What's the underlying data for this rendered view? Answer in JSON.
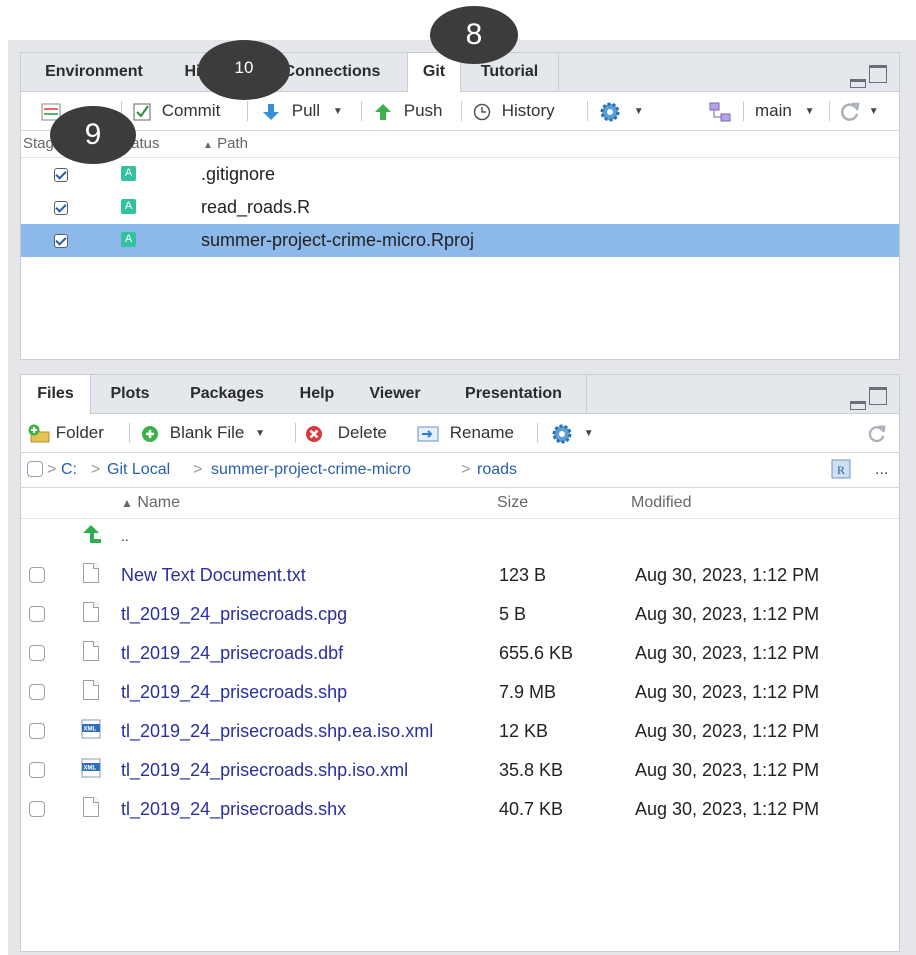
{
  "git_pane": {
    "tabs": [
      {
        "label": "Environment"
      },
      {
        "label": "History"
      },
      {
        "label": "Connections"
      },
      {
        "label": "Git"
      },
      {
        "label": "Tutorial"
      }
    ],
    "toolbar": {
      "commit_label": "Commit",
      "pull_label": "Pull",
      "push_label": "Push",
      "history_label": "History",
      "branch_label": "main"
    },
    "columns": {
      "staged": "Staged",
      "status": "Status",
      "path": "Path"
    },
    "rows": [
      {
        "staged": true,
        "status": "A",
        "path": ".gitignore",
        "selected": false
      },
      {
        "staged": true,
        "status": "A",
        "path": "read_roads.R",
        "selected": false
      },
      {
        "staged": true,
        "status": "A",
        "path": "summer-project-crime-micro.Rproj",
        "selected": true
      }
    ]
  },
  "files_pane": {
    "tabs": [
      {
        "label": "Files"
      },
      {
        "label": "Plots"
      },
      {
        "label": "Packages"
      },
      {
        "label": "Help"
      },
      {
        "label": "Viewer"
      },
      {
        "label": "Presentation"
      }
    ],
    "toolbar": {
      "folder_label": "Folder",
      "blank_file_label": "Blank File",
      "delete_label": "Delete",
      "rename_label": "Rename",
      "more_label": "..."
    },
    "breadcrumb": [
      "C:",
      "Git Local",
      "summer-project-crime-micro",
      "roads"
    ],
    "columns": {
      "name": "Name",
      "size": "Size",
      "modified": "Modified"
    },
    "parent_label": "..",
    "files": [
      {
        "name": "New Text Document.txt",
        "size": "123 B",
        "modified": "Aug 30, 2023, 1:12 PM",
        "icon": "text-file-icon"
      },
      {
        "name": "tl_2019_24_prisecroads.cpg",
        "size": "5 B",
        "modified": "Aug 30, 2023, 1:12 PM",
        "icon": "text-file-icon"
      },
      {
        "name": "tl_2019_24_prisecroads.dbf",
        "size": "655.6 KB",
        "modified": "Aug 30, 2023, 1:12 PM",
        "icon": "text-file-icon"
      },
      {
        "name": "tl_2019_24_prisecroads.shp",
        "size": "7.9 MB",
        "modified": "Aug 30, 2023, 1:12 PM",
        "icon": "text-file-icon"
      },
      {
        "name": "tl_2019_24_prisecroads.shp.ea.iso.xml",
        "size": "12 KB",
        "modified": "Aug 30, 2023, 1:12 PM",
        "icon": "xml-file-icon"
      },
      {
        "name": "tl_2019_24_prisecroads.shp.iso.xml",
        "size": "35.8 KB",
        "modified": "Aug 30, 2023, 1:12 PM",
        "icon": "xml-file-icon"
      },
      {
        "name": "tl_2019_24_prisecroads.shx",
        "size": "40.7 KB",
        "modified": "Aug 30, 2023, 1:12 PM",
        "icon": "text-file-icon"
      }
    ]
  },
  "annotations": [
    "8",
    "9",
    "10"
  ],
  "colors": {
    "selection": "#8db8ea",
    "status_added": "#32c2a0",
    "link": "#2a2fa0",
    "annotation_circle": "#3c3c3c"
  }
}
